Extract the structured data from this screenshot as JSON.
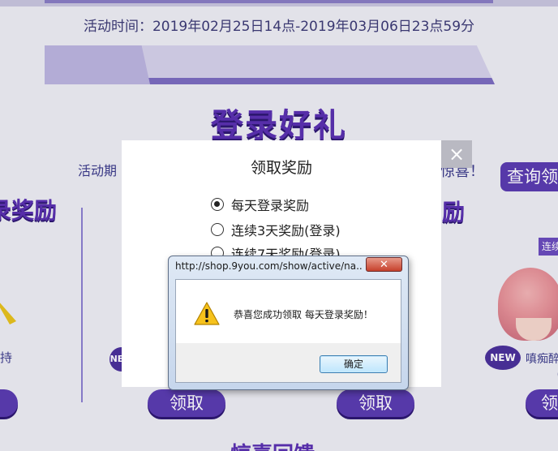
{
  "background_page": {
    "event_time": "活动时间：2019年02月25日14点-2019年03月06日23点59分",
    "section_title": "登录好礼",
    "intro_text": "活动期",
    "intro_text_tail": "惊喜！",
    "query_button_label": "查询领",
    "left_heading": "录奖励",
    "right_heading": "励",
    "consecutive_badge": "连续",
    "left_item_label": "持",
    "right_item_label": "嗔痴醉",
    "right_item_label_2": "（",
    "new_badge_label": "NEW",
    "claim_button_label": "领取",
    "bottom_heading": "惊喜回馈"
  },
  "reward_modal": {
    "title": "领取奖励",
    "close_label": "×",
    "options": [
      {
        "label": "每天登录奖励",
        "checked": true
      },
      {
        "label": "连续3天奖励(登录)",
        "checked": false
      },
      {
        "label": "连续7天奖励(登录)",
        "checked": false
      }
    ]
  },
  "alert_dialog": {
    "title": "http://shop.9you.com/show/active/na...",
    "close_label": "✕",
    "icon": "warning-icon",
    "message": "恭喜您成功领取 每天登录奖励！",
    "ok_label": "确定"
  },
  "colors": {
    "brand_purple": "#5a3bb0",
    "heading_purple": "#5a2fb0",
    "text_navy": "#3b3a8a",
    "warning_yellow": "#f6c21c"
  }
}
